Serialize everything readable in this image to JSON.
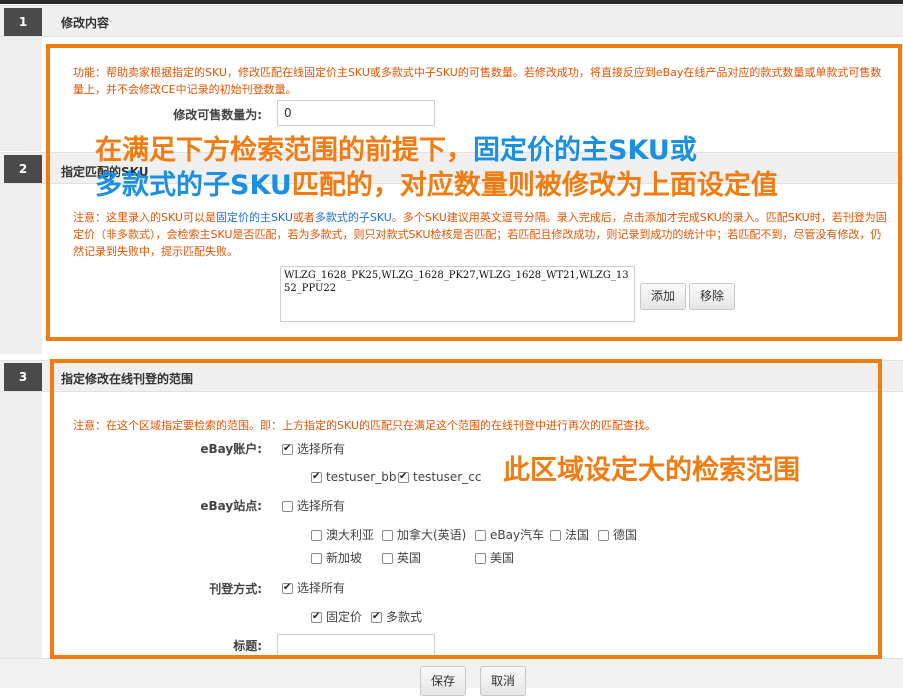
{
  "sections": [
    {
      "num": "1",
      "title": "修改内容"
    },
    {
      "num": "2",
      "title": "指定匹配的SKU"
    },
    {
      "num": "3",
      "title": "指定修改在线刊登的范围"
    }
  ],
  "section1": {
    "note": "功能：帮助卖家根据指定的SKU，修改匹配在线固定价主SKU或多款式中子SKU的可售数量。若修改成功，将直接反应到eBay在线产品对应的款式数量或单款式可售数量上，并不会修改CE中记录的初始刊登数量。",
    "qty_label": "修改可售数量为:",
    "qty_value": "0"
  },
  "section2": {
    "note_a": "注意：这里录入的SKU可以是",
    "note_link1": "固定价的主SKU",
    "note_b": "或者",
    "note_link2": "多款式的子SKU",
    "note_c": "。多个SKU建议用英文逗号分隔。录入完成后，点击添加才完成SKU的录入。匹配SKU时，若刊登为固定价（非多款式），会检索主SKU是否匹配，若为多款式，则只对款式SKU检核是否匹配；若匹配且修改成功，则记录到成功的统计中；若匹配不到，尽管没有修改，仍然记录到失败中，提示匹配失败。",
    "sku_text": "WLZG_1628_PK25,WLZG_1628_PK27,WLZG_1628_WT21,WLZG_1352_PPU22",
    "add_label": "添加",
    "remove_label": "移除"
  },
  "section3": {
    "note": "注意：在这个区域指定要检索的范围。即：上方指定的SKU的匹配只在满足这个范围的在线刊登中进行再次的匹配查找。",
    "account_label": "eBay账户:",
    "account_all": "选择所有",
    "accounts": [
      "testuser_bb",
      "testuser_cc"
    ],
    "site_label": "eBay站点:",
    "site_all": "选择所有",
    "sites_row1": [
      "澳大利亚",
      "加拿大(英语)",
      "eBay汽车",
      "法国",
      "德国"
    ],
    "sites_row2": [
      "新加坡",
      "英国",
      "美国"
    ],
    "format_label": "刊登方式:",
    "format_all": "选择所有",
    "formats": [
      "固定价",
      "多款式"
    ],
    "title_label": "标题:"
  },
  "overlay": {
    "line1_a": "在满足下方检索范围的前提下，",
    "line1_b": "固定价的主SKU或",
    "line2_a": "多款式的子SKU",
    "line2_b": "匹配的，对应数量则被修改为上面设定值",
    "range_text": "此区域设定大的检索范围"
  },
  "footer": {
    "save_label": "保存",
    "cancel_label": "取消"
  },
  "colors": {
    "highlight": "#f07c12",
    "overlay_blue": "#1b8fe0",
    "note": "#e55400",
    "link": "#1f6fd1"
  }
}
